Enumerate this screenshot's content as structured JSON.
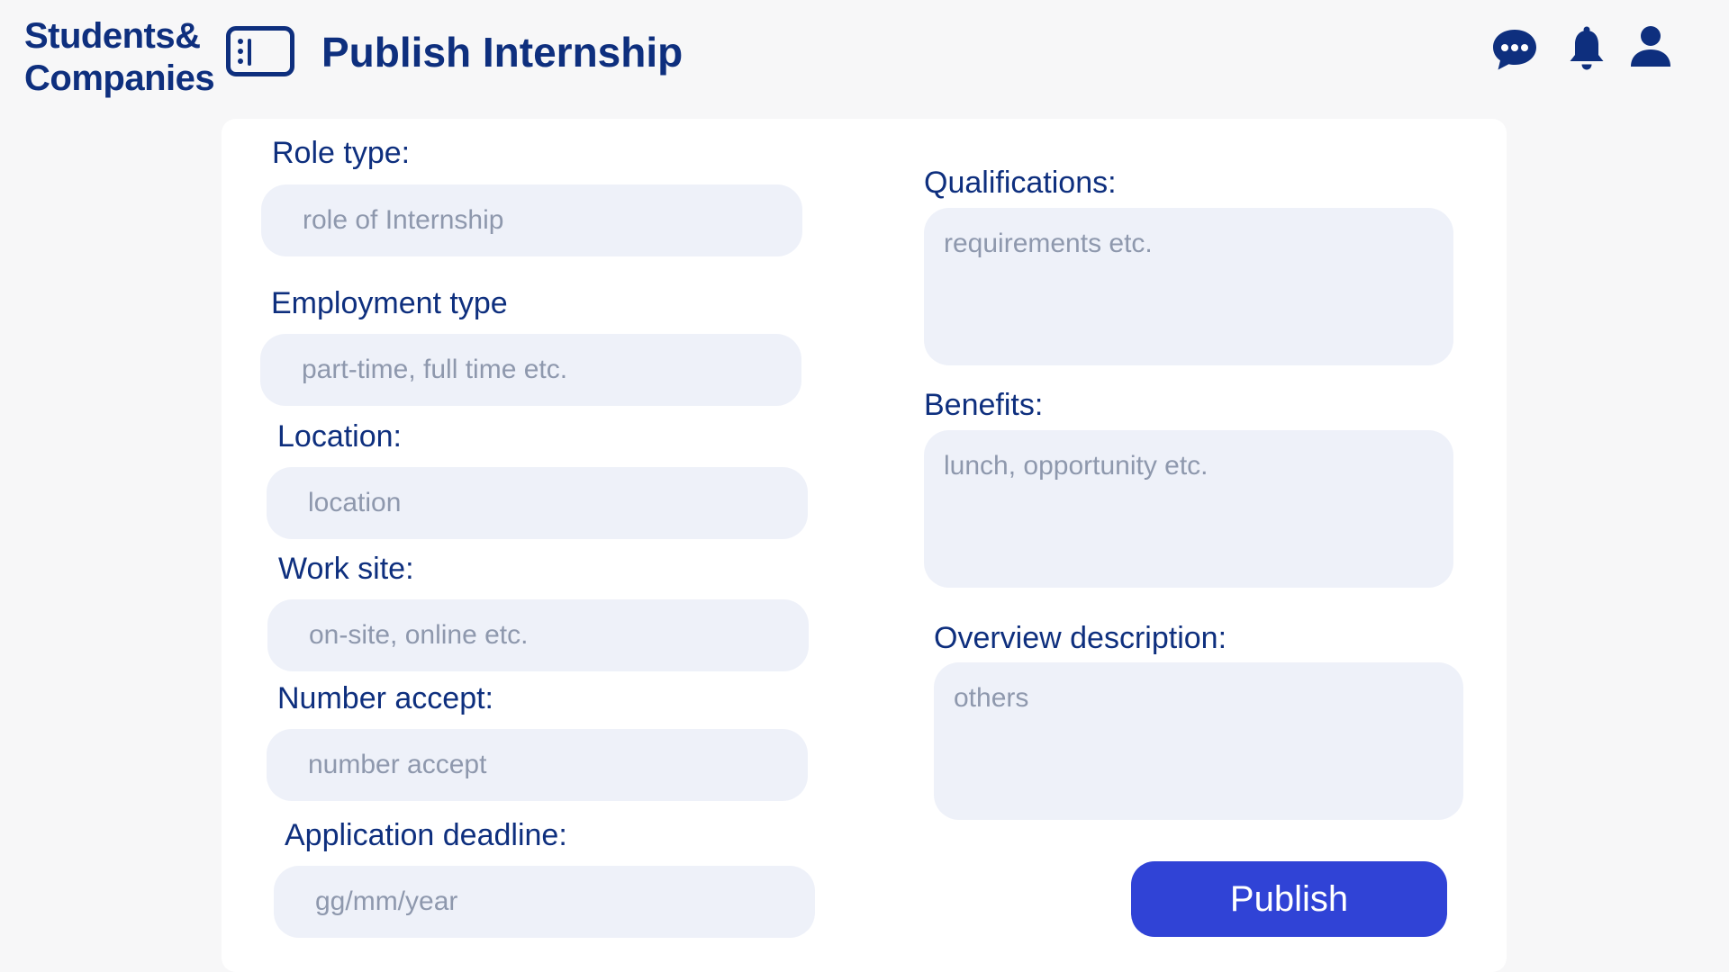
{
  "header": {
    "brand_line1": "Students&",
    "brand_line2": "Companies",
    "page_title": "Publish Internship",
    "icons": [
      "sidebar-toggle-icon",
      "chat-icon",
      "bell-icon",
      "user-icon"
    ]
  },
  "form": {
    "role_type": {
      "label": "Role type:",
      "placeholder": "role of Internship"
    },
    "employment_type": {
      "label": "Employment type",
      "placeholder": "part-time, full time etc."
    },
    "location": {
      "label": "Location:",
      "placeholder": "location"
    },
    "work_site": {
      "label": "Work site:",
      "placeholder": "on-site, online etc."
    },
    "number_accept": {
      "label": "Number accept:",
      "placeholder": "number accept"
    },
    "application_deadline": {
      "label": "Application deadline:",
      "placeholder": "gg/mm/year"
    },
    "qualifications": {
      "label": "Qualifications:",
      "placeholder": "requirements etc."
    },
    "benefits": {
      "label": "Benefits:",
      "placeholder": "lunch, opportunity etc."
    },
    "overview_description": {
      "label": "Overview description:",
      "placeholder": "others"
    },
    "publish_label": "Publish"
  },
  "colors": {
    "primary_text": "#0e2f7e",
    "field_background": "#eef1f9",
    "placeholder": "#8e98ad",
    "button": "#3043d6",
    "page_background": "#f7f7f8",
    "card_background": "#ffffff"
  }
}
